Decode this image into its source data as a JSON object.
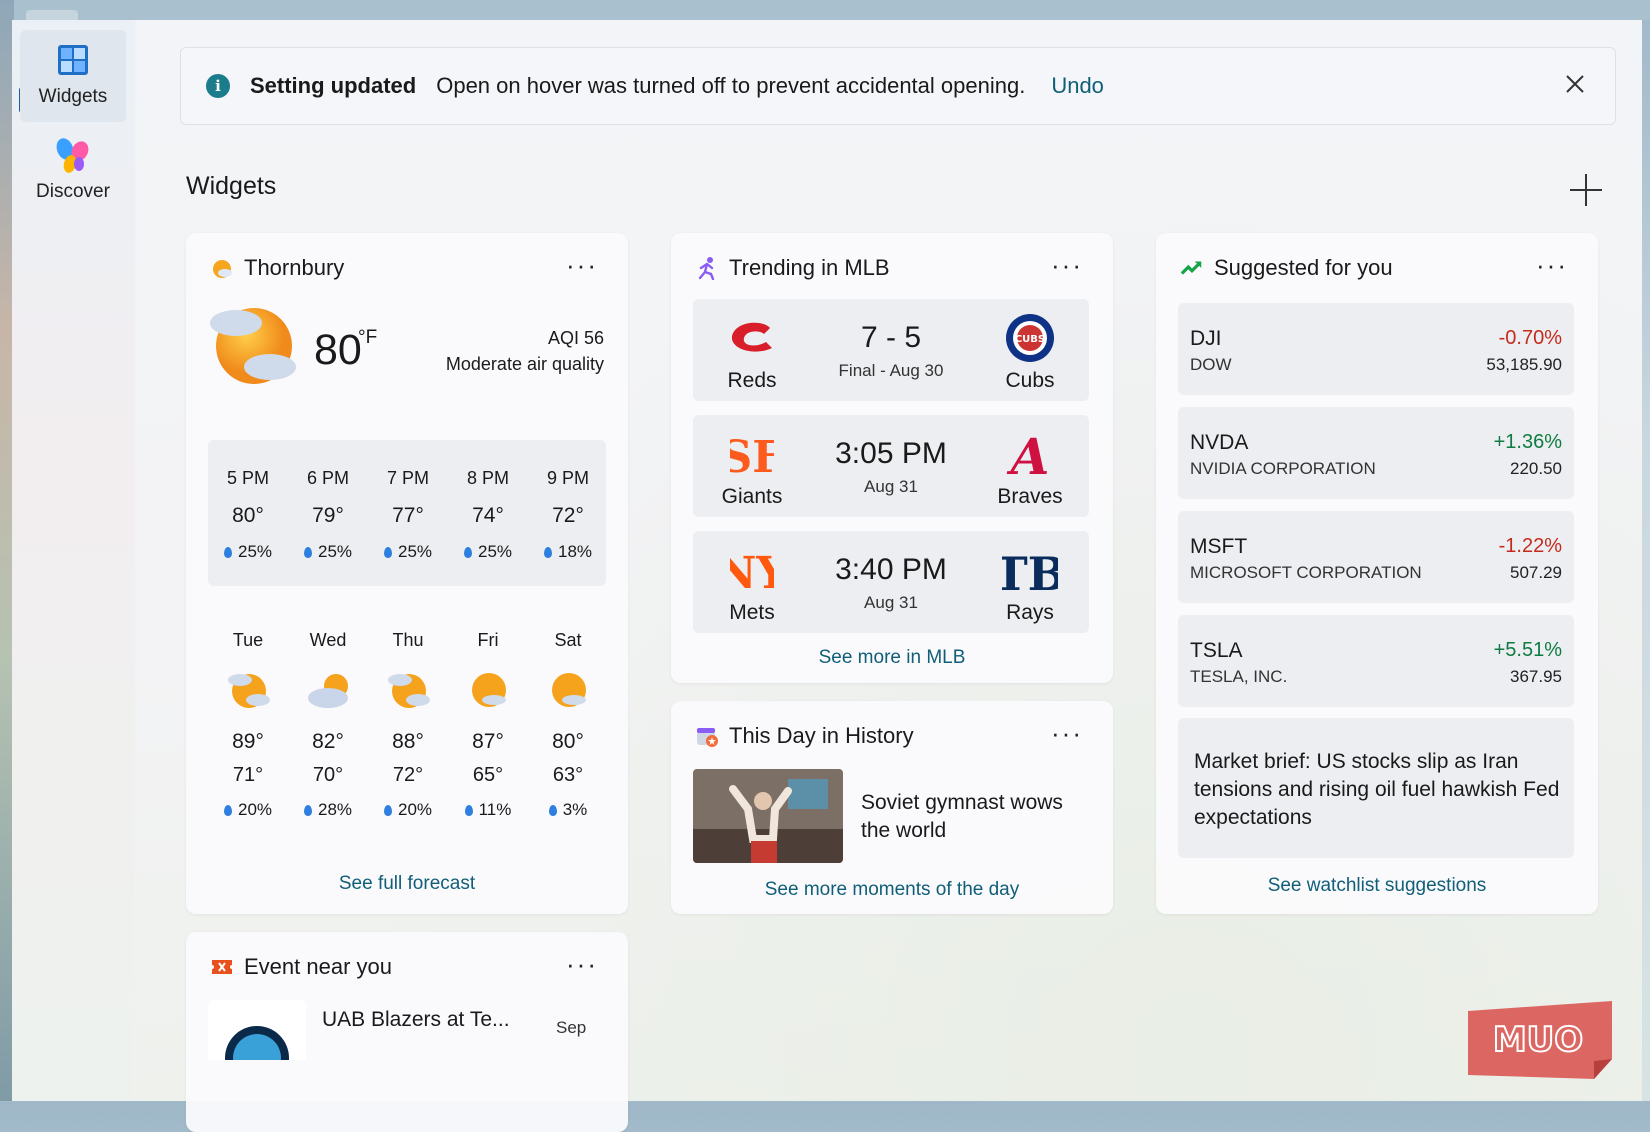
{
  "rail": {
    "items": [
      {
        "label": "Widgets",
        "icon": "widgets-icon",
        "active": true
      },
      {
        "label": "Discover",
        "icon": "discover-icon",
        "active": false
      }
    ]
  },
  "toast": {
    "title": "Setting updated",
    "message": "Open on hover was turned off to prevent accidental opening.",
    "action": "Undo"
  },
  "section": {
    "title": "Widgets"
  },
  "weather": {
    "location": "Thornbury",
    "temp": "80",
    "unit": "°F",
    "aqi": "AQI 56",
    "aqi_text": "Moderate air quality",
    "hourly": [
      {
        "time": "5 PM",
        "temp": "80°",
        "precip": "25%"
      },
      {
        "time": "6 PM",
        "temp": "79°",
        "precip": "25%"
      },
      {
        "time": "7 PM",
        "temp": "77°",
        "precip": "25%"
      },
      {
        "time": "8 PM",
        "temp": "74°",
        "precip": "25%"
      },
      {
        "time": "9 PM",
        "temp": "72°",
        "precip": "18%"
      }
    ],
    "daily": [
      {
        "day": "Tue",
        "hi": "89°",
        "lo": "71°",
        "precip": "20%",
        "icon": "partly-cloudy-icon"
      },
      {
        "day": "Wed",
        "hi": "82°",
        "lo": "70°",
        "precip": "28%",
        "icon": "mostly-cloudy-icon"
      },
      {
        "day": "Thu",
        "hi": "88°",
        "lo": "72°",
        "precip": "20%",
        "icon": "partly-cloudy-icon"
      },
      {
        "day": "Fri",
        "hi": "87°",
        "lo": "65°",
        "precip": "11%",
        "icon": "sunny-cloud-icon"
      },
      {
        "day": "Sat",
        "hi": "80°",
        "lo": "63°",
        "precip": "3%",
        "icon": "sunny-cloud-icon"
      }
    ],
    "link": "See full forecast"
  },
  "mlb": {
    "title": "Trending in MLB",
    "games": [
      {
        "home": "Reds",
        "away": "Cubs",
        "center": "7 - 5",
        "sub": "Final - Aug 30"
      },
      {
        "home": "Giants",
        "away": "Braves",
        "center": "3:05 PM",
        "sub": "Aug 31"
      },
      {
        "home": "Mets",
        "away": "Rays",
        "center": "3:40 PM",
        "sub": "Aug 31"
      }
    ],
    "link": "See more in MLB"
  },
  "history": {
    "title": "This Day in History",
    "story": "Soviet gymnast wows the world",
    "link": "See more moments of the day"
  },
  "stocks": {
    "title": "Suggested for you",
    "items": [
      {
        "symbol": "DJI",
        "name": "DOW",
        "change": "-0.70%",
        "price": "53,185.90",
        "dir": "neg"
      },
      {
        "symbol": "NVDA",
        "name": "NVIDIA CORPORATION",
        "change": "+1.36%",
        "price": "220.50",
        "dir": "pos"
      },
      {
        "symbol": "MSFT",
        "name": "MICROSOFT CORPORATION",
        "change": "-1.22%",
        "price": "507.29",
        "dir": "neg"
      },
      {
        "symbol": "TSLA",
        "name": "TESLA, INC.",
        "change": "+5.51%",
        "price": "367.95",
        "dir": "pos"
      }
    ],
    "brief": "Market brief: US stocks slip as Iran tensions and rising oil fuel hawkish Fed expectations",
    "link": "See watchlist suggestions"
  },
  "event": {
    "title": "Event near you",
    "name": "UAB Blazers at Te...",
    "date": "Sep"
  },
  "watermark": "MUO",
  "colors": {
    "accent": "#105e78",
    "negative": "#c42b1c",
    "positive": "#107c41"
  }
}
